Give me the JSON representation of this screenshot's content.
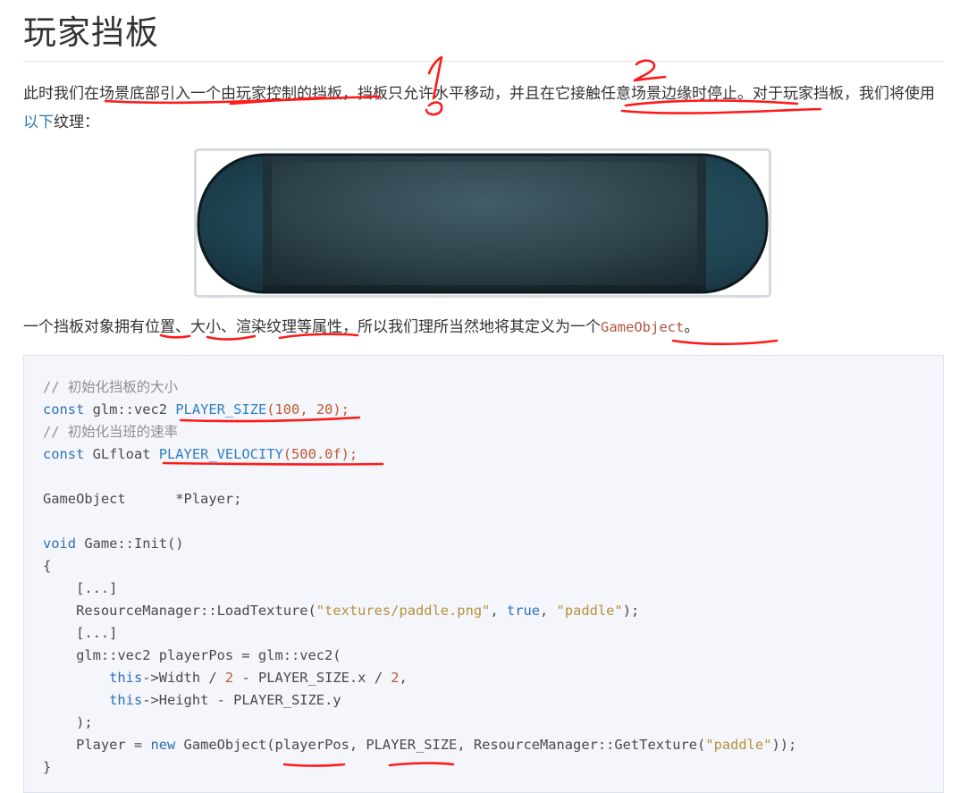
{
  "page": {
    "title": "玩家挡板",
    "para1": {
      "before_link": "此时我们在场景底部引入一个由玩家控制的挡板，挡板只允许水平移动，并且在它接触任意场景边缘时停止。对于玩家挡板，我们将使用",
      "link": "以下",
      "after_link": "纹理："
    },
    "para2": {
      "before_code": "一个挡板对象拥有位置、大小、渲染纹理等属性，所以我们理所当然地将其定义为一个",
      "code": "GameObject",
      "after_code": "。"
    }
  },
  "annotations": {
    "mark1": "1",
    "mark2": "2",
    "color": "#ff1a1a"
  },
  "code": {
    "l1": "// 初始化挡板的大小",
    "l2": {
      "a": "const",
      "b": " glm::vec2 ",
      "c": "PLAYER_SIZE",
      "d": "(",
      "e": "100",
      "f": ", ",
      "g": "20",
      "h": ");"
    },
    "l3": "// 初始化当班的速率",
    "l4": {
      "a": "const",
      "b": " GLfloat ",
      "c": "PLAYER_VELOCITY",
      "d": "(",
      "e": "500.0f",
      "f": ");"
    },
    "l5": "GameObject      *Player;",
    "l6": {
      "a": "void",
      "b": " Game::Init()"
    },
    "l7": "{",
    "l8": "    [...]",
    "l9": {
      "a": "    ResourceManager::LoadTexture(",
      "b": "\"textures/paddle.png\"",
      "c": ", ",
      "d": "true",
      "e": ", ",
      "f": "\"paddle\"",
      "g": ");"
    },
    "l10": "    [...]",
    "l11": "    glm::vec2 playerPos = glm::vec2(",
    "l12": {
      "a": "        ",
      "b": "this",
      "c": "->Width / ",
      "d": "2",
      "e": " - PLAYER_SIZE.x / ",
      "f": "2",
      "g": ","
    },
    "l13": {
      "a": "        ",
      "b": "this",
      "c": "->Height - PLAYER_SIZE.y"
    },
    "l14": "    );",
    "l15": {
      "a": "    Player = ",
      "b": "new",
      "c": " GameObject(playerPos, PLAYER_SIZE, ResourceManager::GetTexture(",
      "d": "\"paddle\"",
      "e": "));"
    },
    "l16": "}"
  }
}
